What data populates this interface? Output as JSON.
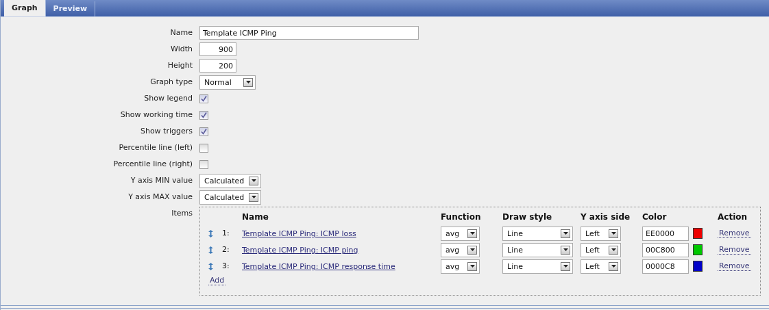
{
  "tabs": [
    {
      "label": "Graph",
      "selected": true
    },
    {
      "label": "Preview",
      "selected": false
    }
  ],
  "fields": [
    {
      "kind": "text",
      "label": "Name",
      "value": "Template ICMP Ping"
    },
    {
      "kind": "number",
      "label": "Width",
      "value": "900"
    },
    {
      "kind": "number",
      "label": "Height",
      "value": "200"
    },
    {
      "kind": "select",
      "label": "Graph type",
      "value": "Normal"
    },
    {
      "kind": "checkbox",
      "label": "Show legend",
      "checked": true
    },
    {
      "kind": "checkbox",
      "label": "Show working time",
      "checked": true
    },
    {
      "kind": "checkbox",
      "label": "Show triggers",
      "checked": true
    },
    {
      "kind": "checkbox",
      "label": "Percentile line (left)",
      "checked": false
    },
    {
      "kind": "checkbox",
      "label": "Percentile line (right)",
      "checked": false
    },
    {
      "kind": "select",
      "label": "Y axis MIN value",
      "value": "Calculated"
    },
    {
      "kind": "select",
      "label": "Y axis MAX value",
      "value": "Calculated"
    }
  ],
  "items": {
    "label": "Items",
    "columns": [
      "Name",
      "Function",
      "Draw style",
      "Y axis side",
      "Color",
      "Action"
    ],
    "rows": [
      {
        "number": "1:",
        "name": "Template ICMP Ping: ICMP loss",
        "function": "avg",
        "draw_style": "Line",
        "y_axis_side": "Left",
        "color_value": "EE0000",
        "color": "#ee0000",
        "action": "Remove"
      },
      {
        "number": "2:",
        "name": "Template ICMP Ping: ICMP ping",
        "function": "avg",
        "draw_style": "Line",
        "y_axis_side": "Left",
        "color_value": "00C800",
        "color": "#00c800",
        "action": "Remove"
      },
      {
        "number": "3:",
        "name": "Template ICMP Ping: ICMP response time",
        "function": "avg",
        "draw_style": "Line",
        "y_axis_side": "Left",
        "color_value": "0000C8",
        "color": "#0000c8",
        "action": "Remove"
      }
    ],
    "add": "Add"
  }
}
